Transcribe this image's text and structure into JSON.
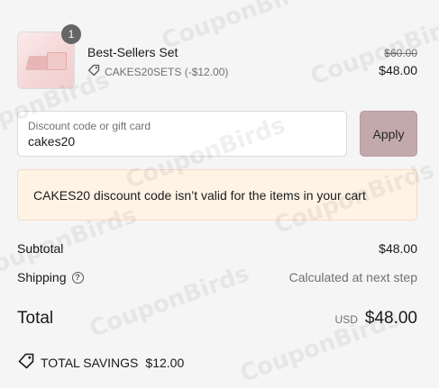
{
  "watermark": {
    "text": "CouponBirds"
  },
  "cart_item": {
    "quantity": "1",
    "name": "Best-Sellers Set",
    "discount_code": "CAKES20SETS (-$12.00)",
    "original_price": "$60.00",
    "price": "$48.00"
  },
  "discount": {
    "label": "Discount code or gift card",
    "value": "cakes20",
    "apply_label": "Apply"
  },
  "error_message": "CAKES20 discount code isn’t valid for the items in your cart",
  "summary": {
    "subtotal_label": "Subtotal",
    "subtotal_value": "$48.00",
    "shipping_label": "Shipping",
    "shipping_value": "Calculated at next step",
    "total_label": "Total",
    "currency": "USD",
    "total_value": "$48.00"
  },
  "savings": {
    "label": "TOTAL SAVINGS",
    "value": "$12.00"
  }
}
